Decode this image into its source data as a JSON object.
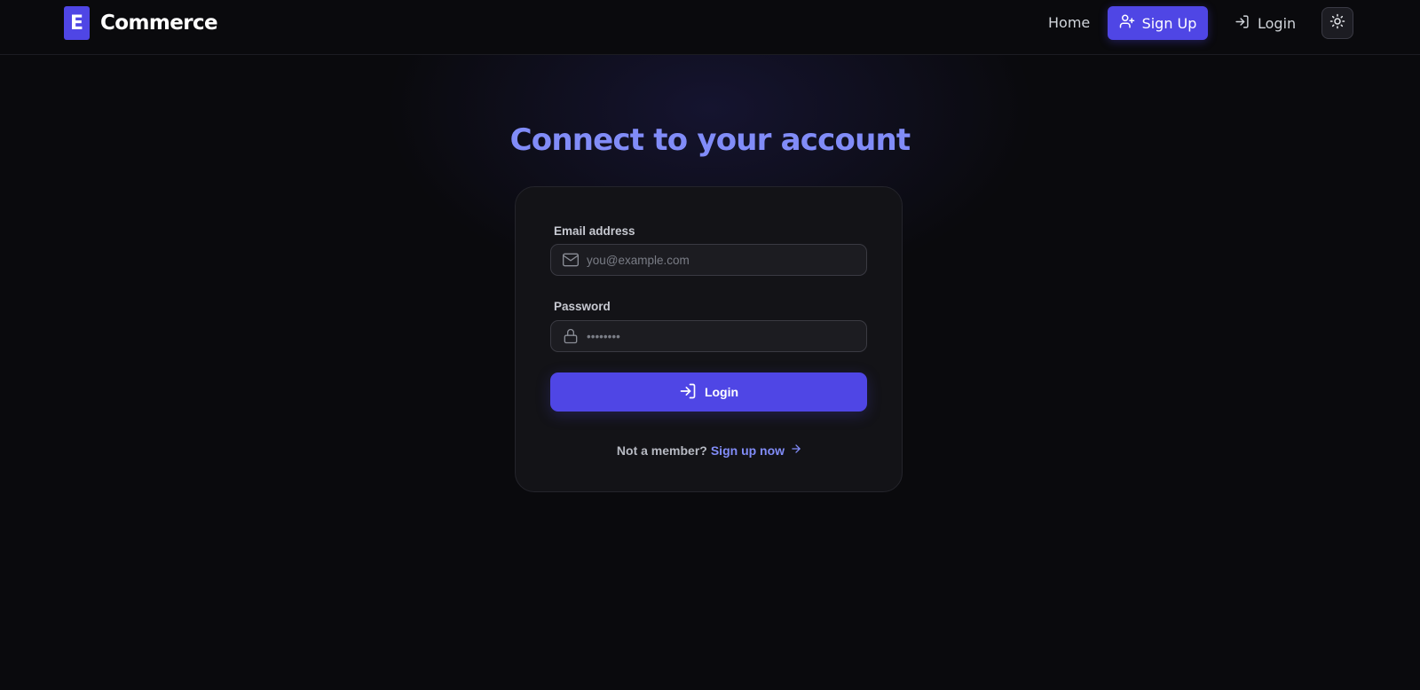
{
  "brand": {
    "logo_letter": "E",
    "name": "Commerce"
  },
  "nav": {
    "home": "Home",
    "signup": "Sign Up",
    "login": "Login",
    "theme_icon": "sun-icon"
  },
  "page": {
    "title": "Connect to your account"
  },
  "form": {
    "email_label": "Email address",
    "email_placeholder": "you@example.com",
    "password_label": "Password",
    "password_placeholder": "••••••••",
    "submit_label": "Login",
    "not_member_text": "Not a member?",
    "signup_link": "Sign up now"
  },
  "colors": {
    "accent": "#4f46e5",
    "accent_light": "#818cf8",
    "background": "#0a0a0d",
    "card": "#131317"
  }
}
